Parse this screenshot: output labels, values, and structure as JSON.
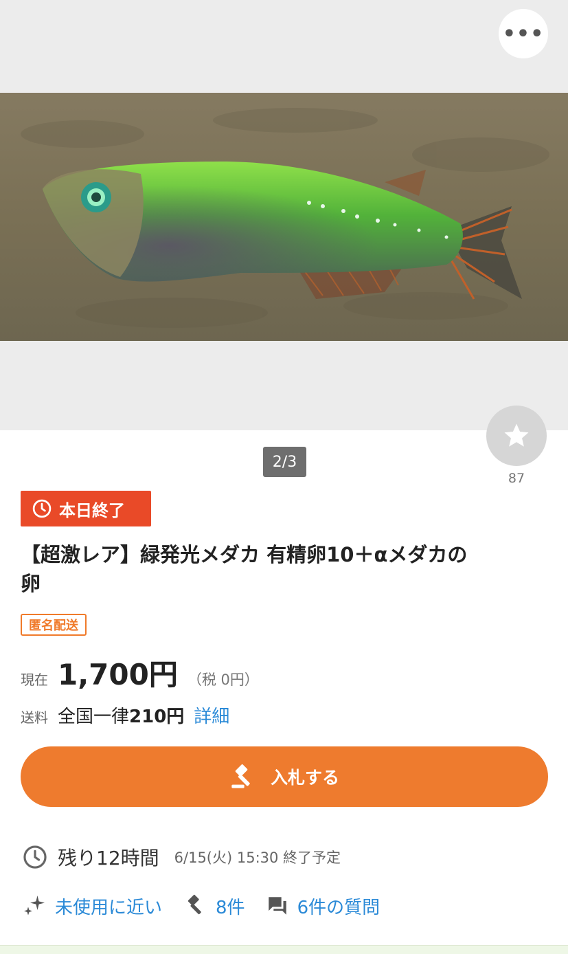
{
  "gallery": {
    "counter": "2/3",
    "watch_count": "87",
    "image_subject": "green glowing medaka fish"
  },
  "badge": {
    "label": "本日終了",
    "icon": "clock-icon"
  },
  "item": {
    "title": "【超激レア】緑発光メダカ 有精卵10＋αメダカの卵",
    "tag": "匿名配送"
  },
  "price": {
    "label": "現在",
    "value": "1,700円",
    "tax": "（税 0円）"
  },
  "shipping": {
    "label": "送料",
    "value_prefix": "全国一律",
    "value_amount": "210円",
    "detail_link": "詳細"
  },
  "bid_button": {
    "label": "入札する",
    "icon": "gavel-icon"
  },
  "time": {
    "remaining": "残り12時間",
    "end_date": "6/15(火) 15:30 終了予定"
  },
  "info": {
    "condition": "未使用に近い",
    "bids": "8件",
    "questions": "6件の質問"
  },
  "colors": {
    "accent_orange": "#ee7b2e",
    "badge_red": "#e94a28",
    "link_blue": "#2b8ad7"
  }
}
